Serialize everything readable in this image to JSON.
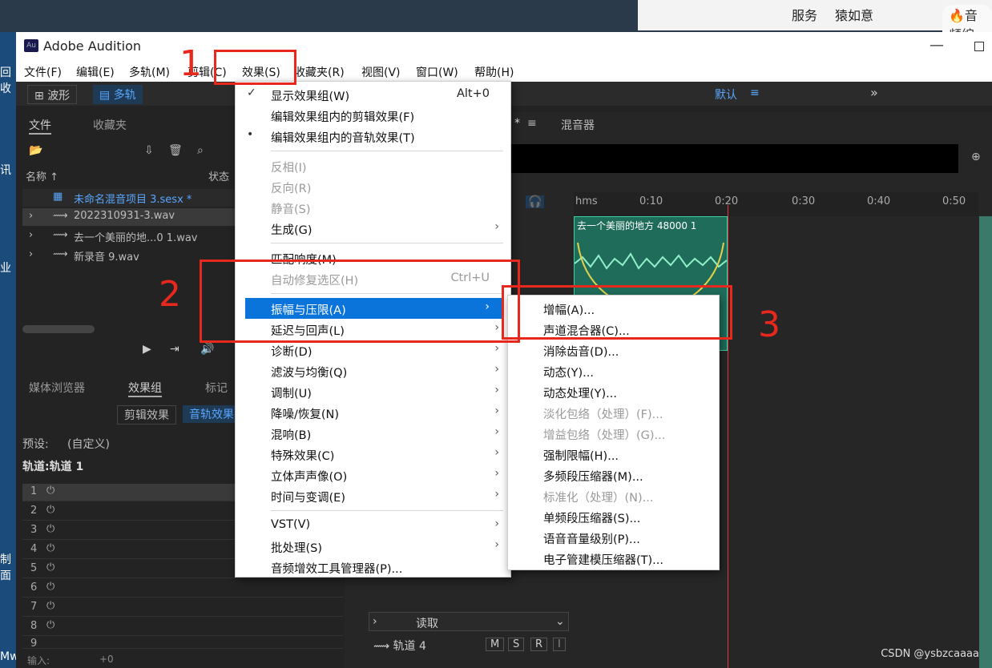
{
  "browser": {
    "tab1": "服务",
    "tab2": "猿如意",
    "tab3": "音频编"
  },
  "desktop": {
    "labels": [
      "回收",
      "讯",
      "业",
      "制面",
      "Mw"
    ]
  },
  "window": {
    "title": "Adobe Audition",
    "logo": "Au"
  },
  "menubar": [
    "文件(F)",
    "编辑(E)",
    "多轨(M)",
    "剪辑(C)",
    "效果(S)",
    "收藏夹(R)",
    "视图(V)",
    "窗口(W)",
    "帮助(H)"
  ],
  "toolbar": {
    "waveform": "波形",
    "multitrack": "多轨",
    "workspace": "默认"
  },
  "files_panel": {
    "tab_files": "文件",
    "tab_favorites": "收藏夹",
    "col_name": "名称 ↑",
    "col_status": "状态",
    "files": [
      "未命名混音项目 3.sesx *",
      "2022310931-3.wav",
      "去一个美丽的地...0 1.wav",
      "新录音 9.wav"
    ]
  },
  "effects_panel": {
    "tab_media": "媒体浏览器",
    "tab_effects": "效果组",
    "tab_markers": "标记",
    "sub_clip": "剪辑效果",
    "sub_track": "音轨效果",
    "preset_label": "预设:",
    "preset_value": "(自定义)",
    "track_label": "轨道:轨道 1",
    "slots": [
      "1",
      "2",
      "3",
      "4",
      "5",
      "6",
      "7",
      "8",
      "9"
    ],
    "input_label": "输入:",
    "input_value": "+0"
  },
  "multitrack": {
    "tab_editor": "*",
    "tab_mixer": "混音器",
    "ruler": [
      "hms",
      "0:10",
      "0:20",
      "0:30",
      "0:40",
      "0:50"
    ],
    "clip_title": "去一个美丽的地方 48000 1",
    "read_mode": "读取",
    "track4": "轨道 4",
    "track_buttons": [
      "M",
      "S",
      "R",
      "I"
    ]
  },
  "effects_menu": {
    "items": [
      {
        "label": "显示效果组(W)",
        "shortcut": "Alt+0",
        "check": "✓"
      },
      {
        "label": "编辑效果组内的剪辑效果(F)"
      },
      {
        "label": "编辑效果组内的音轨效果(T)",
        "check": "•"
      },
      {
        "label": "反相(I)",
        "disabled": true
      },
      {
        "label": "反向(R)",
        "disabled": true
      },
      {
        "label": "静音(S)",
        "disabled": true
      },
      {
        "label": "生成(G)",
        "submenu": true
      },
      {
        "label": "匹配响度(M)"
      },
      {
        "label": "自动修复选区(H)",
        "shortcut": "Ctrl+U",
        "disabled": true
      },
      {
        "label": "振幅与压限(A)",
        "submenu": true,
        "highlight": true
      },
      {
        "label": "延迟与回声(L)",
        "submenu": true
      },
      {
        "label": "诊断(D)",
        "submenu": true
      },
      {
        "label": "滤波与均衡(Q)",
        "submenu": true
      },
      {
        "label": "调制(U)",
        "submenu": true
      },
      {
        "label": "降噪/恢复(N)",
        "submenu": true
      },
      {
        "label": "混响(B)",
        "submenu": true
      },
      {
        "label": "特殊效果(C)",
        "submenu": true
      },
      {
        "label": "立体声声像(O)",
        "submenu": true
      },
      {
        "label": "时间与变调(E)",
        "submenu": true
      },
      {
        "label": "VST(V)",
        "submenu": true
      },
      {
        "label": "批处理(S)",
        "submenu": true
      },
      {
        "label": "音频增效工具管理器(P)..."
      }
    ]
  },
  "amplitude_submenu": {
    "items": [
      {
        "label": "增幅(A)..."
      },
      {
        "label": "声道混合器(C)..."
      },
      {
        "label": "消除齿音(D)..."
      },
      {
        "label": "动态(Y)..."
      },
      {
        "label": "动态处理(Y)..."
      },
      {
        "label": "淡化包络（处理）(F)...",
        "disabled": true
      },
      {
        "label": "增益包络（处理）(G)...",
        "disabled": true
      },
      {
        "label": "强制限幅(H)..."
      },
      {
        "label": "多频段压缩器(M)..."
      },
      {
        "label": "标准化（处理）(N)...",
        "disabled": true
      },
      {
        "label": "单频段压缩器(S)..."
      },
      {
        "label": "语音音量级别(P)..."
      },
      {
        "label": "电子管建模压缩器(T)..."
      }
    ]
  },
  "annotations": {
    "n1": "1",
    "n2": "2",
    "n3": "3",
    "color": "#e8271d"
  },
  "watermark": "CSDN @ysbzcaaaa"
}
